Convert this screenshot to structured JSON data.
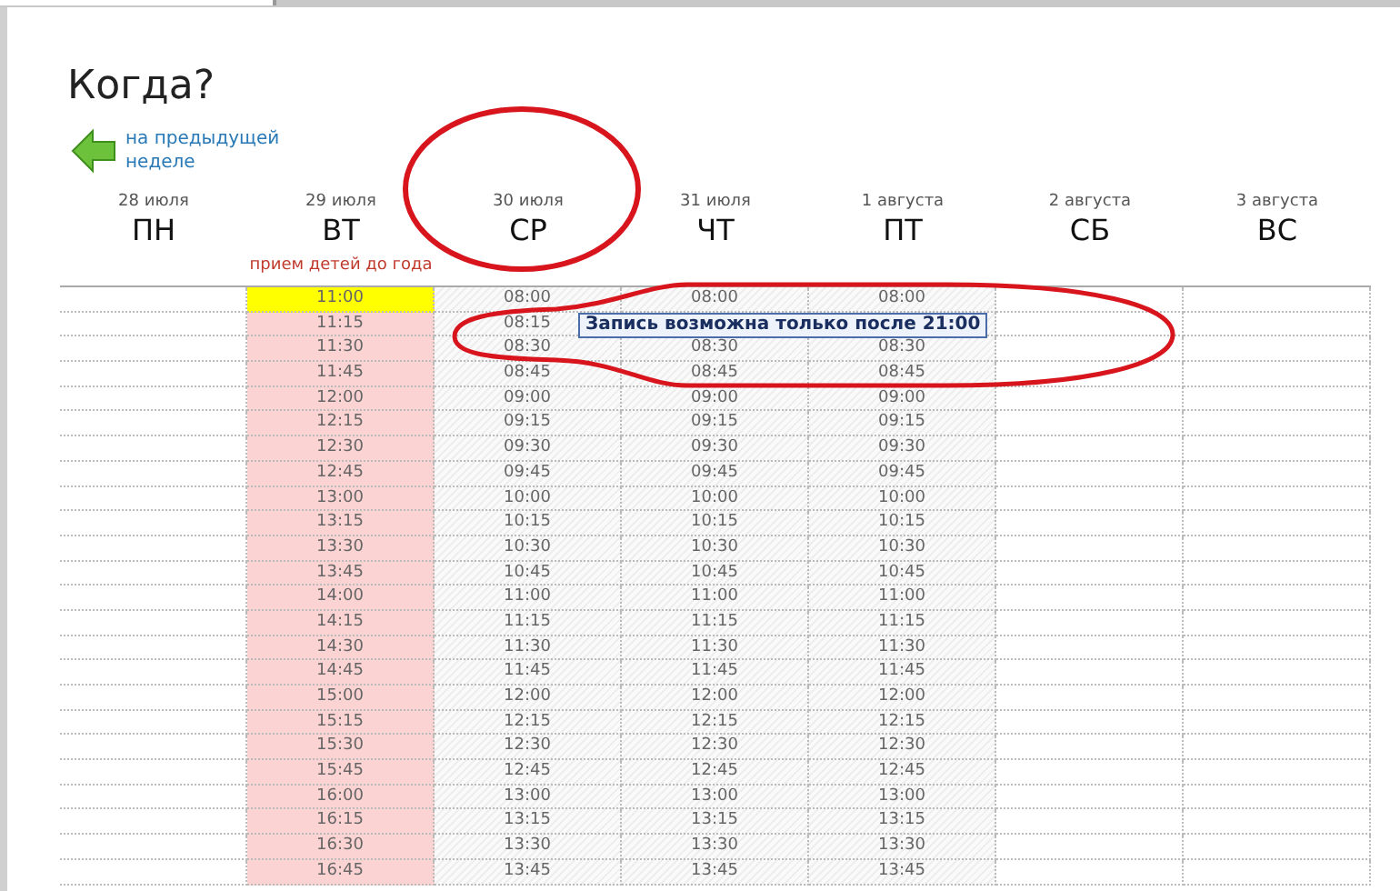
{
  "title": "Когда?",
  "back_link": "на предыдущей неделе",
  "days": [
    {
      "date": "28 июля",
      "name": "ПН",
      "kind": "empty"
    },
    {
      "date": "29 июля",
      "name": "ВТ",
      "kind": "child",
      "note": "прием детей до года",
      "slots": [
        {
          "time": "11:00",
          "selected": true
        },
        {
          "time": "11:15",
          "selected": false
        },
        {
          "time": "11:30",
          "selected": false
        },
        {
          "time": "11:45",
          "selected": false
        },
        {
          "time": "12:00",
          "selected": false
        },
        {
          "time": "12:15",
          "selected": false
        },
        {
          "time": "12:30",
          "selected": false
        },
        {
          "time": "12:45",
          "selected": false
        },
        {
          "time": "13:00",
          "selected": false
        },
        {
          "time": "13:15",
          "selected": false
        },
        {
          "time": "13:30",
          "selected": false
        },
        {
          "time": "13:45",
          "selected": false
        },
        {
          "time": "14:00",
          "selected": false
        },
        {
          "time": "14:15",
          "selected": false
        },
        {
          "time": "14:30",
          "selected": false
        },
        {
          "time": "14:45",
          "selected": false
        },
        {
          "time": "15:00",
          "selected": false
        },
        {
          "time": "15:15",
          "selected": false
        },
        {
          "time": "15:30",
          "selected": false
        },
        {
          "time": "15:45",
          "selected": false
        },
        {
          "time": "16:00",
          "selected": false
        },
        {
          "time": "16:15",
          "selected": false
        },
        {
          "time": "16:30",
          "selected": false
        },
        {
          "time": "16:45",
          "selected": false
        }
      ]
    },
    {
      "date": "30 июля",
      "name": "СР",
      "kind": "locked",
      "slots": [
        {
          "time": "08:00"
        },
        {
          "time": "08:15"
        },
        {
          "time": "08:30"
        },
        {
          "time": "08:45"
        },
        {
          "time": "09:00"
        },
        {
          "time": "09:15"
        },
        {
          "time": "09:30"
        },
        {
          "time": "09:45"
        },
        {
          "time": "10:00"
        },
        {
          "time": "10:15"
        },
        {
          "time": "10:30"
        },
        {
          "time": "10:45"
        },
        {
          "time": "11:00"
        },
        {
          "time": "11:15"
        },
        {
          "time": "11:30"
        },
        {
          "time": "11:45"
        },
        {
          "time": "12:00"
        },
        {
          "time": "12:15"
        },
        {
          "time": "12:30"
        },
        {
          "time": "12:45"
        },
        {
          "time": "13:00"
        },
        {
          "time": "13:15"
        },
        {
          "time": "13:30"
        },
        {
          "time": "13:45"
        }
      ]
    },
    {
      "date": "31 июля",
      "name": "ЧТ",
      "kind": "locked",
      "slots": [
        {
          "time": "08:00"
        },
        {
          "hidden": true
        },
        {
          "time": "08:30"
        },
        {
          "time": "08:45"
        },
        {
          "time": "09:00"
        },
        {
          "time": "09:15"
        },
        {
          "time": "09:30"
        },
        {
          "time": "09:45"
        },
        {
          "time": "10:00"
        },
        {
          "time": "10:15"
        },
        {
          "time": "10:30"
        },
        {
          "time": "10:45"
        },
        {
          "time": "11:00"
        },
        {
          "time": "11:15"
        },
        {
          "time": "11:30"
        },
        {
          "time": "11:45"
        },
        {
          "time": "12:00"
        },
        {
          "time": "12:15"
        },
        {
          "time": "12:30"
        },
        {
          "time": "12:45"
        },
        {
          "time": "13:00"
        },
        {
          "time": "13:15"
        },
        {
          "time": "13:30"
        },
        {
          "time": "13:45"
        }
      ]
    },
    {
      "date": "1 августа",
      "name": "ПТ",
      "kind": "locked",
      "slots": [
        {
          "time": "08:00"
        },
        {
          "hidden": true
        },
        {
          "time": "08:30"
        },
        {
          "time": "08:45"
        },
        {
          "time": "09:00"
        },
        {
          "time": "09:15"
        },
        {
          "time": "09:30"
        },
        {
          "time": "09:45"
        },
        {
          "time": "10:00"
        },
        {
          "time": "10:15"
        },
        {
          "time": "10:30"
        },
        {
          "time": "10:45"
        },
        {
          "time": "11:00"
        },
        {
          "time": "11:15"
        },
        {
          "time": "11:30"
        },
        {
          "time": "11:45"
        },
        {
          "time": "12:00"
        },
        {
          "time": "12:15"
        },
        {
          "time": "12:30"
        },
        {
          "time": "12:45"
        },
        {
          "time": "13:00"
        },
        {
          "time": "13:15"
        },
        {
          "time": "13:30"
        },
        {
          "time": "13:45"
        }
      ]
    },
    {
      "date": "2 августа",
      "name": "СБ",
      "kind": "empty"
    },
    {
      "date": "3 августа",
      "name": "ВС",
      "kind": "empty"
    }
  ],
  "tooltip": "Запись возможна только после 21:00"
}
